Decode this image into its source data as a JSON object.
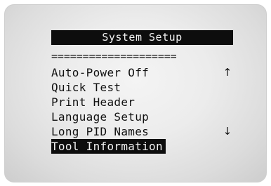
{
  "screen": {
    "title": "System Setup",
    "divider": "====================",
    "menu": [
      {
        "label": "Auto-Power Off",
        "indicator": "↑",
        "indicator_icon": "scroll-up-arrow-icon",
        "selected": false
      },
      {
        "label": "Quick Test",
        "selected": false
      },
      {
        "label": "Print Header",
        "selected": false
      },
      {
        "label": "Language Setup",
        "selected": false
      },
      {
        "label": "Long PID Names",
        "indicator": "↓",
        "indicator_icon": "scroll-down-arrow-icon",
        "selected": false
      },
      {
        "label": "Tool Information",
        "selected": true
      }
    ]
  },
  "colors": {
    "lcd_background": "#e6e6e6",
    "text": "#111111",
    "highlight": "#0d0d0d",
    "highlight_text": "#f2f2f2"
  }
}
